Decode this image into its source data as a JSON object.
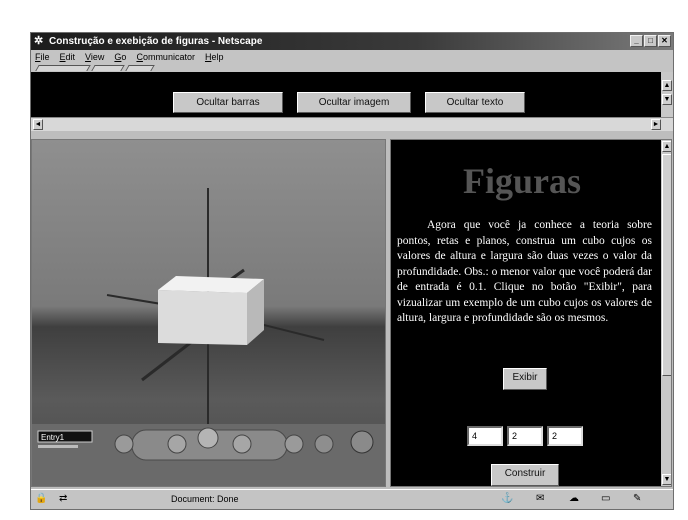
{
  "window": {
    "title": "Construção e exebição de figuras - Netscape"
  },
  "menu": [
    "File",
    "Edit",
    "View",
    "Go",
    "Communicator",
    "Help"
  ],
  "top_buttons": {
    "hide_bars": "Ocultar barras",
    "hide_image": "Ocultar imagem",
    "hide_text": "Ocultar texto"
  },
  "viewer": {
    "mode_label": "Entry1"
  },
  "panel": {
    "title": "Figuras",
    "text": "Agora que você ja conhece a teoria sobre pontos, retas e planos, construa um cubo cujos os valores de altura e largura são duas vezes o valor da profundidade. Obs.: o menor valor que você poderá dar de entrada é 0.1. Clique no botão \"Exibir\", para vizualizar um exemplo de um cubo cujos os valores de altura, largura e profundidade são os mesmos.",
    "show_button": "Exibir",
    "inputs": [
      "4",
      "2",
      "2"
    ],
    "build_button": "Construir"
  },
  "status": {
    "text": "Document: Done"
  }
}
